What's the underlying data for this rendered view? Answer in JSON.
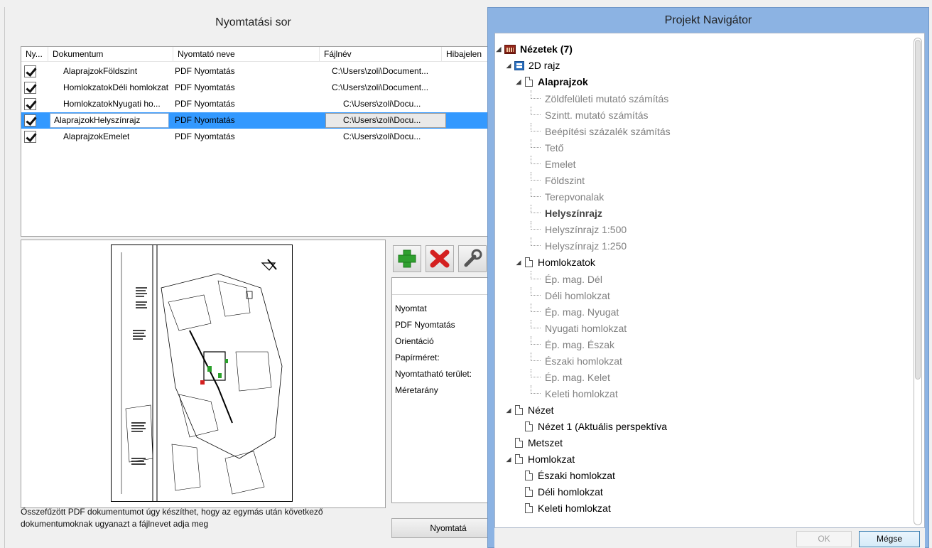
{
  "print_queue": {
    "title": "Nyomtatási sor",
    "columns": [
      "Ny...",
      "Dokumentum",
      "Nyomtató neve",
      "Fájlnév",
      "Hibajelen"
    ],
    "rows": [
      {
        "doc": "AlaprajzokFöldszint",
        "printer": "PDF Nyomtatás",
        "file": "C:\\Users\\zoli\\Document...",
        "checked": true
      },
      {
        "doc": "HomlokzatokDéli homlokzat",
        "printer": "PDF Nyomtatás",
        "file": "C:\\Users\\zoli\\Document...",
        "checked": true
      },
      {
        "doc": "HomlokzatokNyugati ho...",
        "printer": "PDF Nyomtatás",
        "file": "C:\\Users\\zoli\\Docu...",
        "checked": true
      },
      {
        "doc": "AlaprajzokHelyszínrajz",
        "printer": "PDF Nyomtatás",
        "file": "C:\\Users\\zoli\\Docu...",
        "checked": true,
        "selected": true
      },
      {
        "doc": "AlaprajzokEmelet",
        "printer": "PDF Nyomtatás",
        "file": "C:\\Users\\zoli\\Docu...",
        "checked": true
      }
    ],
    "tools": [
      {
        "name": "add-icon",
        "color": "#2fa02f"
      },
      {
        "name": "delete-icon",
        "color": "#d42020"
      },
      {
        "name": "wrench-icon",
        "color": "#555555"
      }
    ],
    "props": {
      "nyomtat": "Nyomtat",
      "pdf": "PDF Nyomtatás",
      "orientacio": "Orientáció",
      "papirmeret": "Papírméret:",
      "terulet": "Nyomtatható terület:",
      "meretarany": "Méretarány"
    },
    "footnote": "Összefűzött PDF dokumentumot úgy készíthet, hogy az egymás után következő dokumentumoknak ugyanazt a fájlnevet adja meg",
    "print_button": "Nyomtatá"
  },
  "navigator": {
    "title": "Projekt Navigátor",
    "tree": {
      "root": "Nézetek (7)",
      "d2": "2D rajz",
      "alaprajzok": "Alaprajzok",
      "alaprajzok_items": [
        {
          "label": "Zöldfelületi mutató számítás",
          "bold": false
        },
        {
          "label": "Szintt. mutató számítás",
          "bold": false
        },
        {
          "label": "Beépítési százalék számítás",
          "bold": false
        },
        {
          "label": "Tető",
          "bold": false
        },
        {
          "label": "Emelet",
          "bold": false
        },
        {
          "label": "Földszint",
          "bold": false
        },
        {
          "label": "Terepvonalak",
          "bold": false
        },
        {
          "label": "Helyszínrajz",
          "bold": true
        },
        {
          "label": "Helyszínrajz 1:500",
          "bold": false
        },
        {
          "label": "Helyszínrajz 1:250",
          "bold": false
        }
      ],
      "homlokzatok": "Homlokzatok",
      "homlokzatok_items": [
        "Ép. mag. Dél",
        "Déli homlokzat",
        "Ép. mag. Nyugat",
        "Nyugati homlokzat",
        "Ép. mag. Észak",
        "Északi homlokzat",
        "Ép. mag. Kelet",
        "Keleti homlokzat"
      ],
      "nezet": "Nézet",
      "nezet_items": [
        "Nézet 1 (Aktuális perspektíva"
      ],
      "metszet": "Metszet",
      "homlokzat": "Homlokzat",
      "homlokzat_items": [
        "Északi homlokzat",
        "Déli homlokzat",
        "Keleti homlokzat"
      ]
    },
    "ok_button": "OK",
    "cancel_button": "Mégse"
  }
}
